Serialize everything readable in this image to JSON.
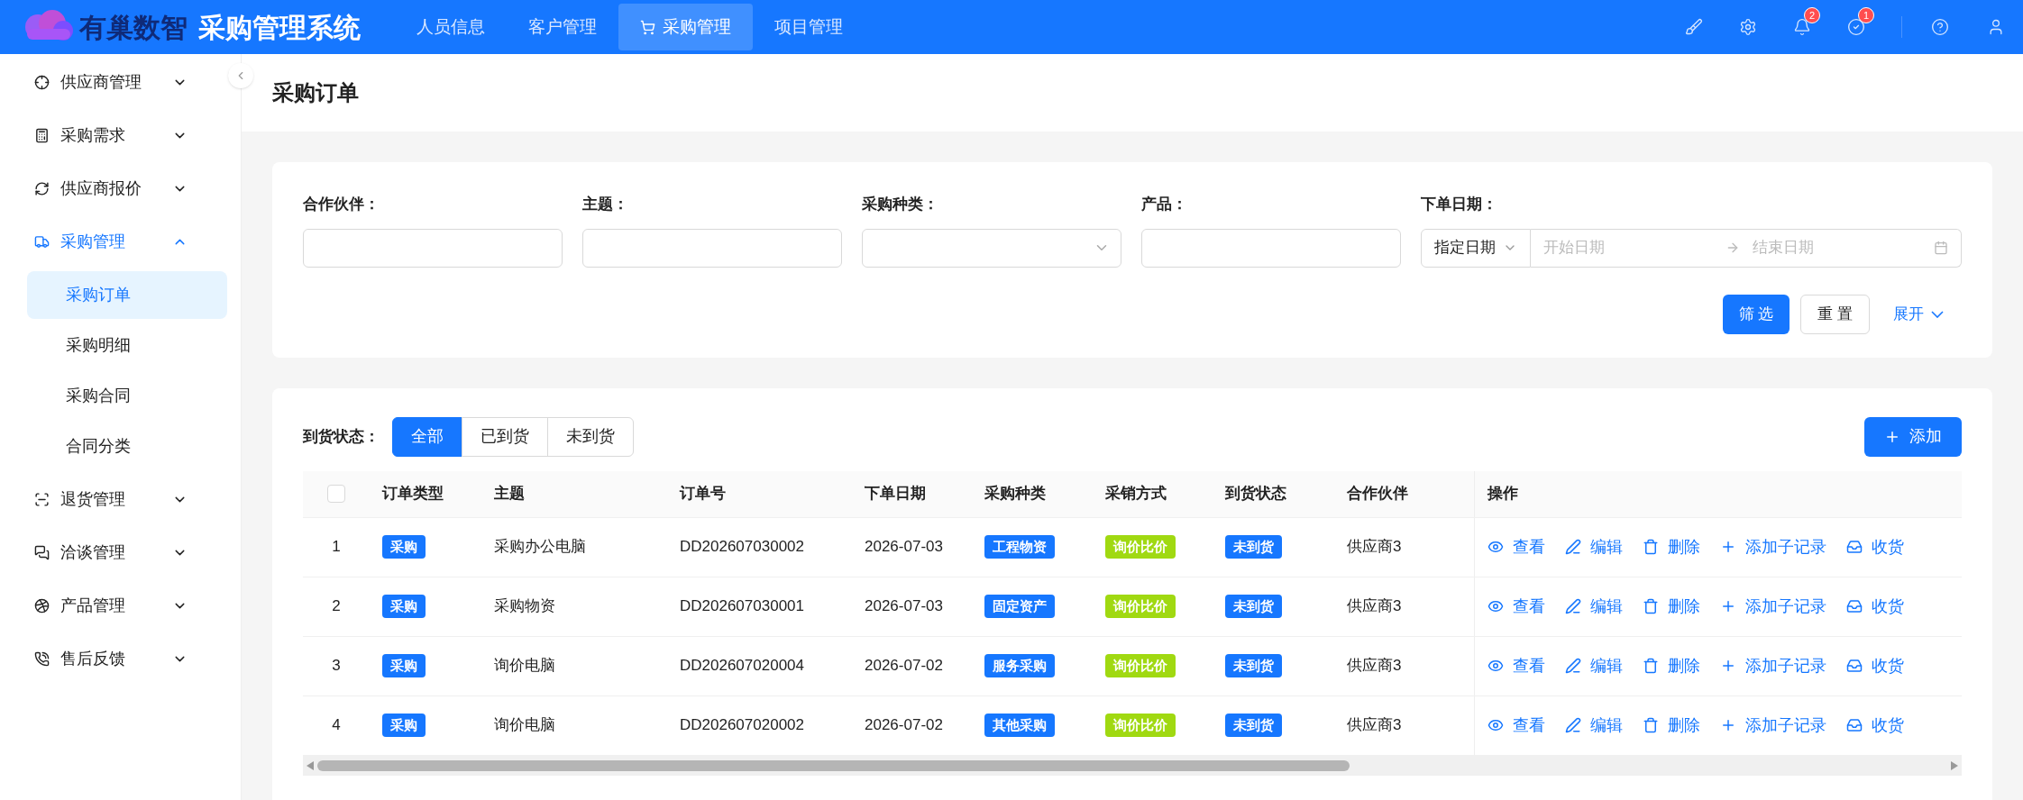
{
  "header": {
    "logo_text": "有巢数智",
    "app_title": "采购管理系统",
    "nav": [
      {
        "label": "人员信息",
        "selected": false
      },
      {
        "label": "客户管理",
        "selected": false
      },
      {
        "label": "采购管理",
        "selected": true
      },
      {
        "label": "项目管理",
        "selected": false
      }
    ],
    "tools": [
      {
        "kind": "brush"
      },
      {
        "kind": "settings"
      },
      {
        "kind": "bell",
        "badge": "2"
      },
      {
        "kind": "tasks",
        "badge": "1"
      },
      {
        "kind": "help"
      },
      {
        "kind": "user"
      }
    ]
  },
  "sidebar": {
    "items": [
      {
        "label": "供应商管理",
        "expanded": false
      },
      {
        "label": "采购需求",
        "expanded": false
      },
      {
        "label": "供应商报价",
        "expanded": false
      },
      {
        "label": "采购管理",
        "expanded": true,
        "children": [
          {
            "label": "采购订单",
            "selected": true
          },
          {
            "label": "采购明细",
            "selected": false
          },
          {
            "label": "采购合同",
            "selected": false
          },
          {
            "label": "合同分类",
            "selected": false
          }
        ]
      },
      {
        "label": "退货管理",
        "expanded": false
      },
      {
        "label": "洽谈管理",
        "expanded": false
      },
      {
        "label": "产品管理",
        "expanded": false
      },
      {
        "label": "售后反馈",
        "expanded": false
      }
    ]
  },
  "page_title": "采购订单",
  "filters": {
    "fields": [
      {
        "label": "合作伙伴：",
        "kind": "text"
      },
      {
        "label": "主题：",
        "kind": "text"
      },
      {
        "label": "采购种类：",
        "kind": "select"
      },
      {
        "label": "产品：",
        "kind": "text"
      },
      {
        "label": "下单日期：",
        "kind": "daterange",
        "mode": "指定日期",
        "start_placeholder": "开始日期",
        "end_placeholder": "结束日期"
      }
    ],
    "search_button": "筛 选",
    "reset_button": "重 置",
    "expand_link": "展开"
  },
  "status_filter": {
    "label": "到货状态：",
    "options": [
      {
        "label": "全部",
        "selected": true
      },
      {
        "label": "已到货",
        "selected": false
      },
      {
        "label": "未到货",
        "selected": false
      }
    ]
  },
  "add_button": "添加",
  "table": {
    "select_all_checked": false,
    "columns": [
      "订单类型",
      "主题",
      "订单号",
      "下单日期",
      "采购种类",
      "采销方式",
      "到货状态",
      "合作伙伴",
      "操作"
    ],
    "rows": [
      {
        "index": "1",
        "order_type": "采购",
        "subject": "采购办公电脑",
        "order_no": "DD202607030002",
        "date": "2026-07-03",
        "category": "工程物资",
        "method": "询价比价",
        "arrival": "未到货",
        "partner": "供应商3",
        "actions": [
          {
            "kind": "view",
            "label": "查看"
          },
          {
            "kind": "edit",
            "label": "编辑"
          },
          {
            "kind": "delete",
            "label": "删除"
          },
          {
            "kind": "add",
            "label": "添加子记录"
          },
          {
            "kind": "receive",
            "label": "收货"
          }
        ]
      },
      {
        "index": "2",
        "order_type": "采购",
        "subject": "采购物资",
        "order_no": "DD202607030001",
        "date": "2026-07-03",
        "category": "固定资产",
        "method": "询价比价",
        "arrival": "未到货",
        "partner": "供应商3",
        "actions": [
          {
            "kind": "view",
            "label": "查看"
          },
          {
            "kind": "edit",
            "label": "编辑"
          },
          {
            "kind": "delete",
            "label": "删除"
          },
          {
            "kind": "add",
            "label": "添加子记录"
          },
          {
            "kind": "receive",
            "label": "收货"
          }
        ]
      },
      {
        "index": "3",
        "order_type": "采购",
        "subject": "询价电脑",
        "order_no": "DD202607020004",
        "date": "2026-07-02",
        "category": "服务采购",
        "method": "询价比价",
        "arrival": "未到货",
        "partner": "供应商3",
        "actions": [
          {
            "kind": "view",
            "label": "查看"
          },
          {
            "kind": "edit",
            "label": "编辑"
          },
          {
            "kind": "delete",
            "label": "删除"
          },
          {
            "kind": "add",
            "label": "添加子记录"
          },
          {
            "kind": "receive",
            "label": "收货"
          }
        ]
      },
      {
        "index": "4",
        "order_type": "采购",
        "subject": "询价电脑",
        "order_no": "DD202607020002",
        "date": "2026-07-02",
        "category": "其他采购",
        "method": "询价比价",
        "arrival": "未到货",
        "partner": "供应商3",
        "actions": [
          {
            "kind": "view",
            "label": "查看"
          },
          {
            "kind": "edit",
            "label": "编辑"
          },
          {
            "kind": "delete",
            "label": "删除"
          },
          {
            "kind": "add",
            "label": "添加子记录"
          },
          {
            "kind": "receive",
            "label": "收货"
          }
        ]
      }
    ]
  }
}
